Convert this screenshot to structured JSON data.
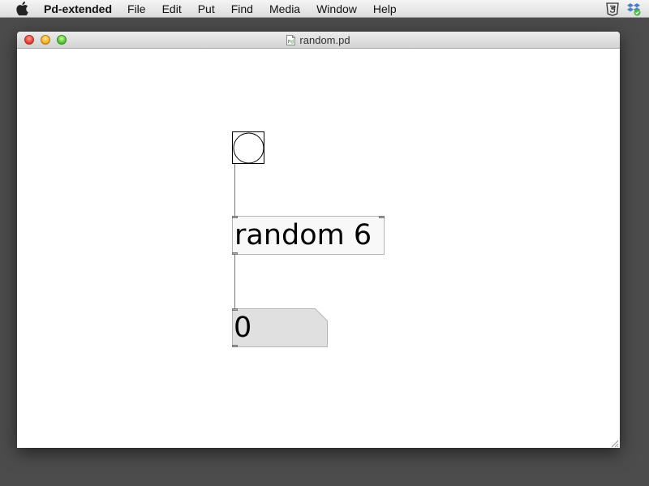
{
  "menubar": {
    "app_name": "Pd-extended",
    "items": [
      "File",
      "Edit",
      "Put",
      "Find",
      "Media",
      "Window",
      "Help"
    ],
    "tray_icons": [
      "html5-shield-icon",
      "dropbox-icon"
    ]
  },
  "window": {
    "title": "random.pd",
    "controls": [
      "close",
      "minimize",
      "zoom"
    ]
  },
  "patch": {
    "bang": {
      "type": "bng"
    },
    "object": {
      "text": "random 6"
    },
    "number": {
      "value": "0"
    }
  },
  "colors": {
    "desktop": "#4c4c4c",
    "canvas": "#ffffff",
    "object_fill": "#f8f8f8",
    "number_fill": "#e0e0e0",
    "wire": "#777777"
  }
}
